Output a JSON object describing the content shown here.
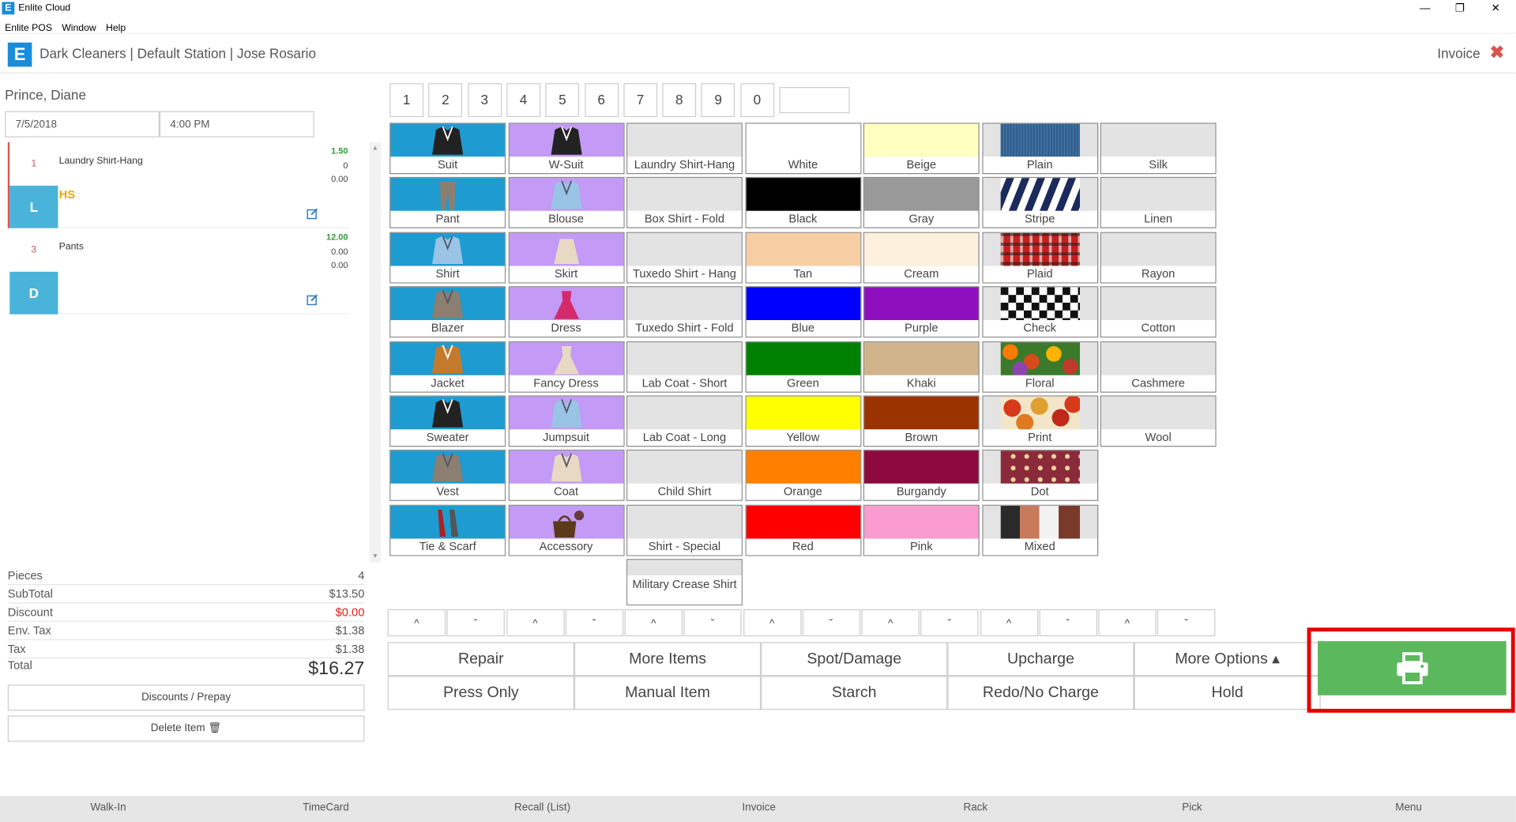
{
  "window": {
    "title": "Enlite Cloud",
    "logo": "E"
  },
  "menu": [
    "Enlite POS",
    "Window",
    "Help"
  ],
  "header": {
    "logo": "E",
    "crumb": "Dark Cleaners | Default Station | Jose Rosario",
    "right_title": "Invoice"
  },
  "customer": {
    "name": "Prince, Diane",
    "date": "7/5/2018",
    "time": "4:00 PM"
  },
  "orders": [
    {
      "qty": "1",
      "name": "Laundry Shirt-Hang",
      "code": "L",
      "tag": "HS",
      "price": "1.50",
      "line2": "0",
      "line3": "0.00"
    },
    {
      "qty": "3",
      "name": "Pants",
      "code": "D",
      "tag": "",
      "price": "12.00",
      "line2": "0.00",
      "line3": "0.00"
    }
  ],
  "summary": [
    {
      "label": "Pieces",
      "value": "4",
      "color": "#555"
    },
    {
      "label": "SubTotal",
      "value": "$13.50",
      "color": "#555"
    },
    {
      "label": "Discount",
      "value": "$0.00",
      "color": "#e02020"
    },
    {
      "label": "Env. Tax",
      "value": "$1.38",
      "color": "#555"
    },
    {
      "label": "Tax",
      "value": "$1.38",
      "color": "#555"
    }
  ],
  "total": {
    "label": "Total",
    "value": "$16.27"
  },
  "left_buttons": {
    "discounts": "Discounts / Prepay",
    "delete": "Delete Item"
  },
  "numbers": [
    "1",
    "2",
    "3",
    "4",
    "5",
    "6",
    "7",
    "8",
    "9",
    "0"
  ],
  "columns": [
    {
      "kind": "garment",
      "color": "#1e9bd0",
      "items": [
        "Suit",
        "Pant",
        "Shirt",
        "Blazer",
        "Jacket",
        "Sweater",
        "Vest",
        "Tie & Scarf"
      ]
    },
    {
      "kind": "garment",
      "color": "#c39af5",
      "items": [
        "W-Suit",
        "Blouse",
        "Skirt",
        "Dress",
        "Fancy Dress",
        "Jumpsuit",
        "Coat",
        "Accessory"
      ]
    },
    {
      "kind": "plain",
      "color": "#e3e3e3",
      "items": [
        "Laundry Shirt-Hang",
        "Box Shirt - Fold",
        "Tuxedo Shirt - Hang",
        "Tuxedo Shirt - Fold",
        "Lab Coat - Short",
        "Lab Coat - Long",
        "Child Shirt",
        "Shirt - Special",
        "Military Crease Shirt"
      ]
    },
    {
      "kind": "color",
      "items": [
        {
          "label": "White",
          "color": "#ffffff"
        },
        {
          "label": "Black",
          "color": "#000000"
        },
        {
          "label": "Tan",
          "color": "#f7cea4"
        },
        {
          "label": "Blue",
          "color": "#0000ff"
        },
        {
          "label": "Green",
          "color": "#008000"
        },
        {
          "label": "Yellow",
          "color": "#ffff00"
        },
        {
          "label": "Orange",
          "color": "#ff7f00"
        },
        {
          "label": "Red",
          "color": "#ff0000"
        }
      ]
    },
    {
      "kind": "color",
      "items": [
        {
          "label": "Beige",
          "color": "#ffffc0"
        },
        {
          "label": "Gray",
          "color": "#999999"
        },
        {
          "label": "Cream",
          "color": "#fdf0dc"
        },
        {
          "label": "Purple",
          "color": "#8f0fbf"
        },
        {
          "label": "Khaki",
          "color": "#d2b48c"
        },
        {
          "label": "Brown",
          "color": "#9a3300"
        },
        {
          "label": "Burgandy",
          "color": "#8c0a3e"
        },
        {
          "label": "Pink",
          "color": "#fb9cd0"
        }
      ]
    },
    {
      "kind": "pattern",
      "items": [
        {
          "label": "Plain",
          "p": "plain"
        },
        {
          "label": "Stripe",
          "p": "stripe"
        },
        {
          "label": "Plaid",
          "p": "plaid"
        },
        {
          "label": "Check",
          "p": "check"
        },
        {
          "label": "Floral",
          "p": "floral"
        },
        {
          "label": "Print",
          "p": "print"
        },
        {
          "label": "Dot",
          "p": "dot"
        },
        {
          "label": "Mixed",
          "p": "mixed"
        }
      ]
    },
    {
      "kind": "plain",
      "color": "#e3e3e3",
      "items": [
        "Silk",
        "Linen",
        "Rayon",
        "Cotton",
        "Cashmere",
        "Wool"
      ]
    }
  ],
  "actions": [
    [
      "Repair",
      "More Items",
      "Spot/Damage",
      "Upcharge",
      "More Options ▴"
    ],
    [
      "Press Only",
      "Manual Item",
      "Starch",
      "Redo/No Charge",
      "Hold"
    ]
  ],
  "print_icon": "printer-icon",
  "bottom_nav": [
    "Walk-In",
    "TimeCard",
    "Recall (List)",
    "Invoice",
    "Rack",
    "Pick",
    "Menu"
  ]
}
